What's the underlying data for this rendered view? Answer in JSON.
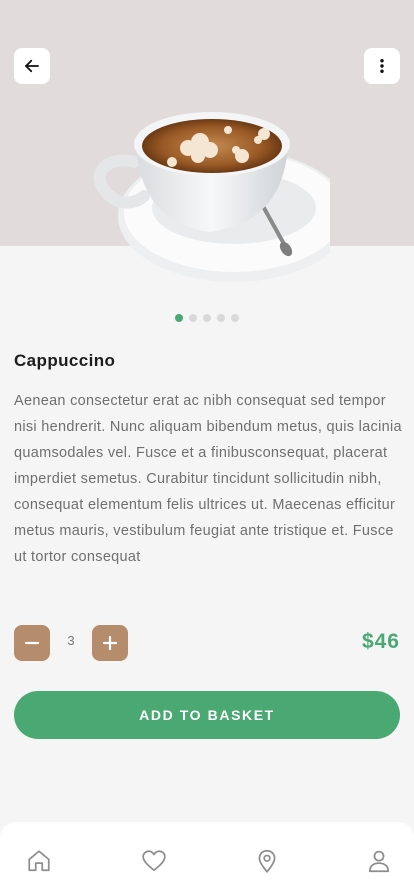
{
  "header": {
    "back_icon": "arrow-left-icon",
    "more_icon": "more-vertical-icon"
  },
  "product": {
    "image": "cappuccino-cup-image",
    "carousel": {
      "total": 5,
      "active": 1
    },
    "name": "Cappuccino",
    "description": "Aenean consectetur erat ac nibh consequat sed tempor nisi hendrerit. Nunc aliquam bibendum metus, quis lacinia quamsodales vel. Fusce et a finibusconsequat, placerat imperdiet semetus. Curabitur tincidunt sollicitudin nibh, consequat elementum felis ultrices ut. Maecenas efficitur metus mauris, vestibulum feugiat ante tristique et. Fusce ut tortor consequat",
    "quantity": "3",
    "price": "$46"
  },
  "actions": {
    "add_to_basket": "ADD TO BASKET"
  },
  "nav": {
    "items": [
      "home-icon",
      "heart-icon",
      "location-pin-icon",
      "user-icon"
    ]
  },
  "colors": {
    "accent": "#4aa872",
    "stepper": "#b58c6c",
    "hero_bg": "#e1dcdb"
  }
}
